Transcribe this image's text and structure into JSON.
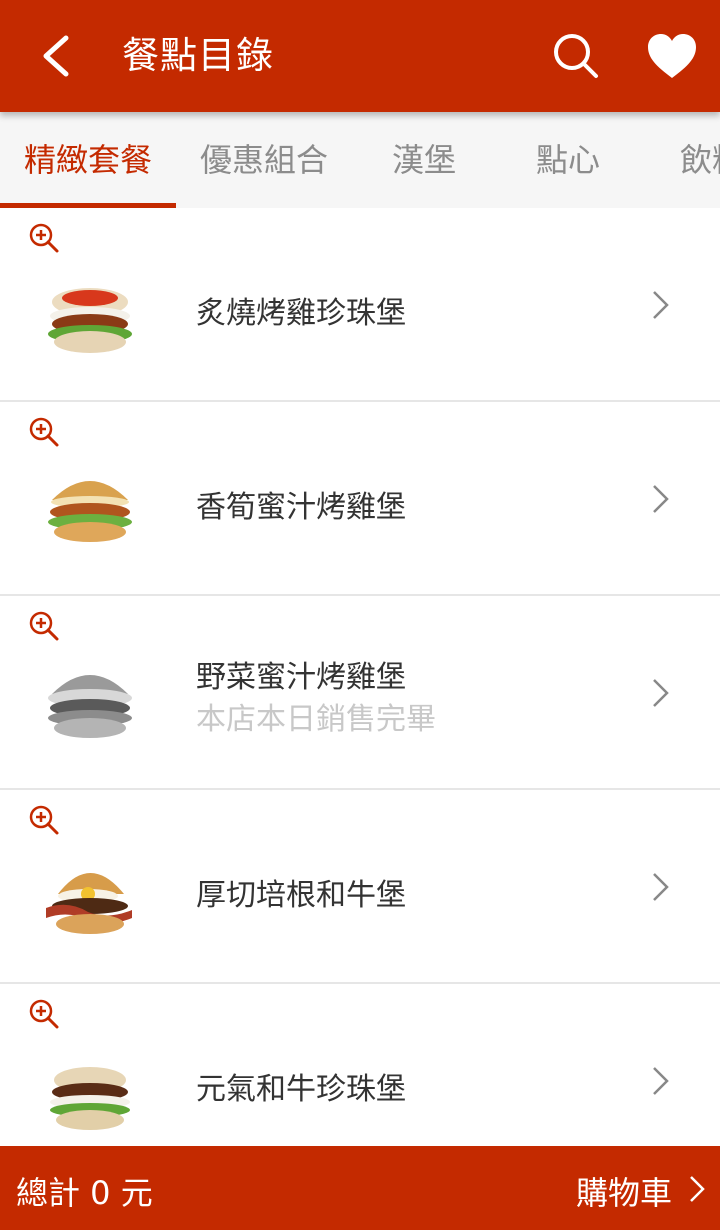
{
  "header": {
    "title": "餐點目錄",
    "back_icon": "chevron-left-icon",
    "search_icon": "search-icon",
    "favorite_icon": "heart-icon"
  },
  "tabs": [
    {
      "label": "精緻套餐",
      "active": true
    },
    {
      "label": "優惠組合",
      "active": false
    },
    {
      "label": "漢堡",
      "active": false
    },
    {
      "label": "點心",
      "active": false
    },
    {
      "label": "飲料",
      "active": false
    }
  ],
  "items": [
    {
      "name": "炙燒烤雞珍珠堡",
      "status": "",
      "image": "rice-burger-chicken"
    },
    {
      "name": "香筍蜜汁烤雞堡",
      "status": "",
      "image": "chicken-burger"
    },
    {
      "name": "野菜蜜汁烤雞堡",
      "status": "本店本日銷售完畢",
      "image": "veggie-chicken-burger-grayscale"
    },
    {
      "name": "厚切培根和牛堡",
      "status": "",
      "image": "bacon-wagyu-burger"
    },
    {
      "name": "元氣和牛珍珠堡",
      "status": "",
      "image": "wagyu-rice-burger"
    }
  ],
  "footer": {
    "total_label": "總計 0 元",
    "cart_label": "購物車",
    "cart_icon": "chevron-right-icon"
  },
  "colors": {
    "brand_red": "#c42a00",
    "text_dark": "#333333",
    "text_muted": "#8c8c8c",
    "sold_out_text": "#c8c8c8",
    "tab_bar_bg": "#f6f6f6"
  }
}
